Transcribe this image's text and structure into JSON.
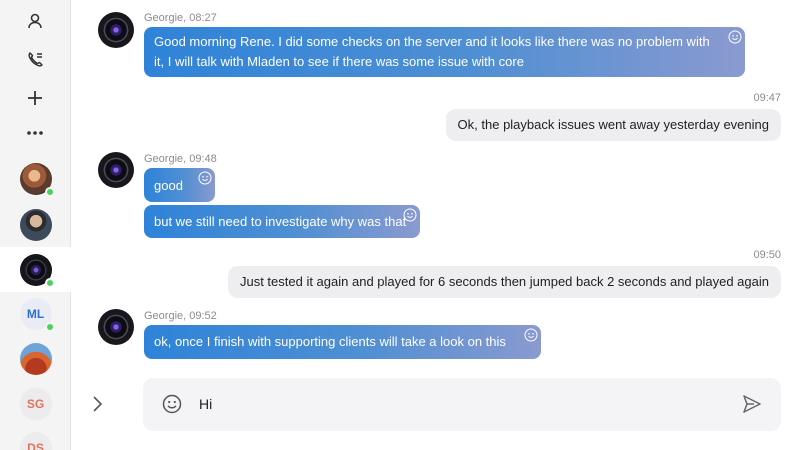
{
  "sidebar": {
    "actions": [
      {
        "icon": "person-icon"
      },
      {
        "icon": "phone-list-icon"
      },
      {
        "icon": "plus-icon"
      },
      {
        "icon": "more-icon"
      }
    ],
    "contacts": [
      {
        "type": "photo",
        "online": true
      },
      {
        "type": "photo",
        "online": false
      },
      {
        "type": "lens",
        "online": true,
        "active": true
      },
      {
        "initials": "ML",
        "online": true
      },
      {
        "type": "photo",
        "online": false
      },
      {
        "initials": "SG",
        "online": false
      },
      {
        "initials": "DS",
        "online": false
      }
    ]
  },
  "conversation": {
    "messages": [
      {
        "direction": "in",
        "meta": "Georgie, 08:27",
        "text": "Good morning Rene. I did some checks on the server and it looks like there was no problem with it, I will talk with Mladen to see if there was some issue with core"
      },
      {
        "direction": "out",
        "meta": "09:47",
        "text": "Ok, the playback issues went away yesterday evening"
      },
      {
        "direction": "in",
        "meta": "Georgie, 09:48",
        "text": "good"
      },
      {
        "direction": "in",
        "meta": "",
        "text": "but we still need to investigate why was that"
      },
      {
        "direction": "out",
        "meta": "09:50",
        "text": "Just tested it again and played for 6 seconds then jumped back 2 seconds and played again"
      },
      {
        "direction": "in",
        "meta": "Georgie, 09:52",
        "text": "ok, once I finish with supporting clients will take a look on this one"
      }
    ]
  },
  "composer": {
    "value": "Hi",
    "emoji_icon": "smiley-icon",
    "send_icon": "send-icon",
    "expand_icon": "chevron-right-icon"
  },
  "colors": {
    "incoming_start": "#2e83d9",
    "incoming_end": "#8a9ad0",
    "outgoing": "#eeeef1",
    "online": "#4cd05f",
    "initials": "#e2725b",
    "initials_ml": "#2f6fcf"
  }
}
